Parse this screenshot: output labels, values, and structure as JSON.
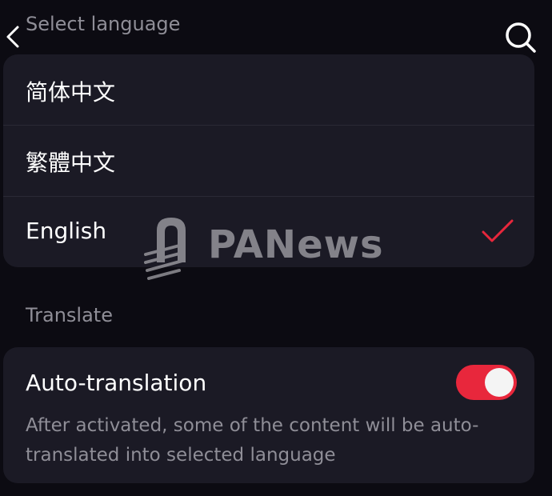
{
  "header": {
    "title": "Select language",
    "back_icon": "chevron-left-icon",
    "search_icon": "search-icon"
  },
  "languages": [
    {
      "label": "简体中文",
      "selected": false
    },
    {
      "label": "繁體中文",
      "selected": false
    },
    {
      "label": "English",
      "selected": true
    }
  ],
  "translate": {
    "section_label": "Translate",
    "auto_label": "Auto-translation",
    "auto_enabled": true,
    "description": "After activated, some of the content will be auto-translated into selected language"
  },
  "watermark": {
    "text": "PANews"
  },
  "colors": {
    "background": "#0c0b12",
    "card": "#1b1a25",
    "accent": "#e8273c",
    "muted_text": "#8f8e97"
  }
}
